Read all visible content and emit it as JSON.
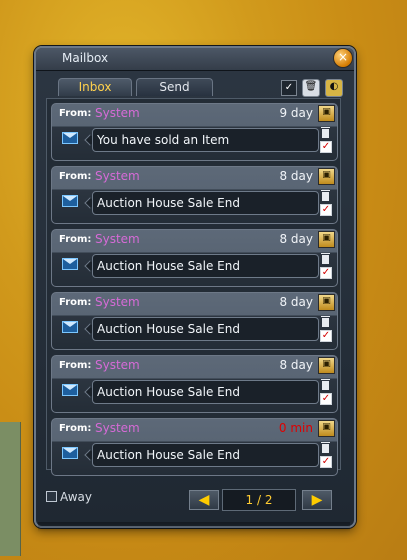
{
  "window": {
    "title": "Mailbox",
    "close_icon": "×"
  },
  "tabs": [
    {
      "label": "Inbox",
      "active": true
    },
    {
      "label": "Send",
      "active": false
    }
  ],
  "header_icons": {
    "check": "✓",
    "trash": "🗑",
    "select": "◐"
  },
  "mails": [
    {
      "from_label": "From:",
      "from": "System",
      "age": "9 day",
      "subject": "You have sold an Item",
      "expired": false
    },
    {
      "from_label": "From:",
      "from": "System",
      "age": "8 day",
      "subject": "Auction House Sale End",
      "expired": false
    },
    {
      "from_label": "From:",
      "from": "System",
      "age": "8 day",
      "subject": "Auction House Sale End",
      "expired": false
    },
    {
      "from_label": "From:",
      "from": "System",
      "age": "8 day",
      "subject": "Auction House Sale End",
      "expired": false
    },
    {
      "from_label": "From:",
      "from": "System",
      "age": "8 day",
      "subject": "Auction House Sale End",
      "expired": false
    },
    {
      "from_label": "From:",
      "from": "System",
      "age": "0 min",
      "subject": "Auction House Sale End",
      "expired": true
    }
  ],
  "footer": {
    "away_label": "Away",
    "page": "1 / 2",
    "prev_icon": "◀",
    "next_icon": "▶"
  },
  "colors": {
    "sender": "#d66bd7",
    "expired_age": "#e00000",
    "accent": "#ffd14d"
  }
}
